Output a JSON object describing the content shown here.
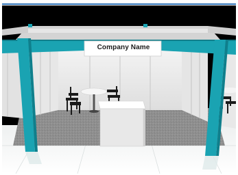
{
  "scene": {
    "sign": {
      "text": "Company Name"
    },
    "colors": {
      "accent": "#1aa3b2",
      "accent_dark": "#0f7f8c",
      "background": "#000000",
      "panel": "#ececec",
      "carpet": "#8c8c8c",
      "floor": "#f7f8f8"
    }
  }
}
